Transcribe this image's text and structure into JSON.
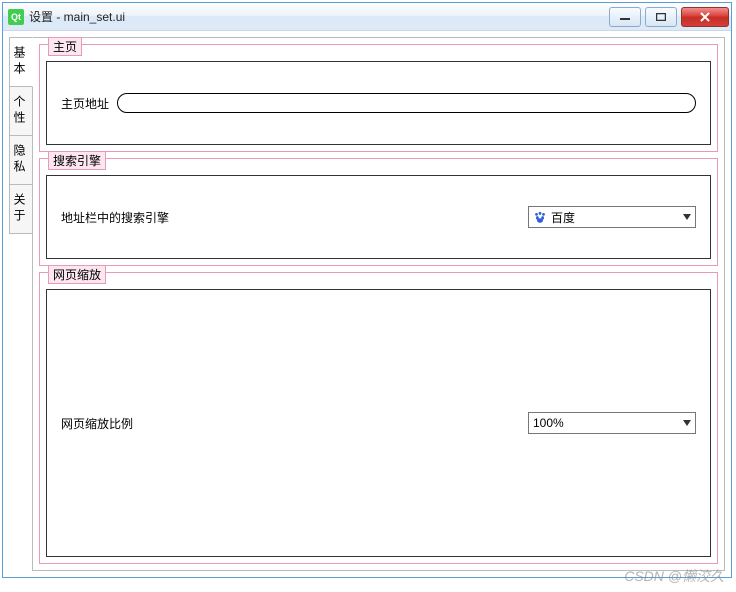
{
  "window": {
    "logo_text": "Qt",
    "title": "设置 - main_set.ui"
  },
  "tabs": [
    "基本",
    "个性",
    "隐私",
    "关于"
  ],
  "group_homepage": {
    "legend": "主页",
    "label": "主页地址",
    "value": ""
  },
  "group_search": {
    "legend": "搜索引擎",
    "label": "地址栏中的搜索引擎",
    "selected": "百度"
  },
  "group_zoom": {
    "legend": "网页缩放",
    "label": "网页缩放比例",
    "selected": "100%"
  },
  "watermark": "CSDN @懒洨久"
}
